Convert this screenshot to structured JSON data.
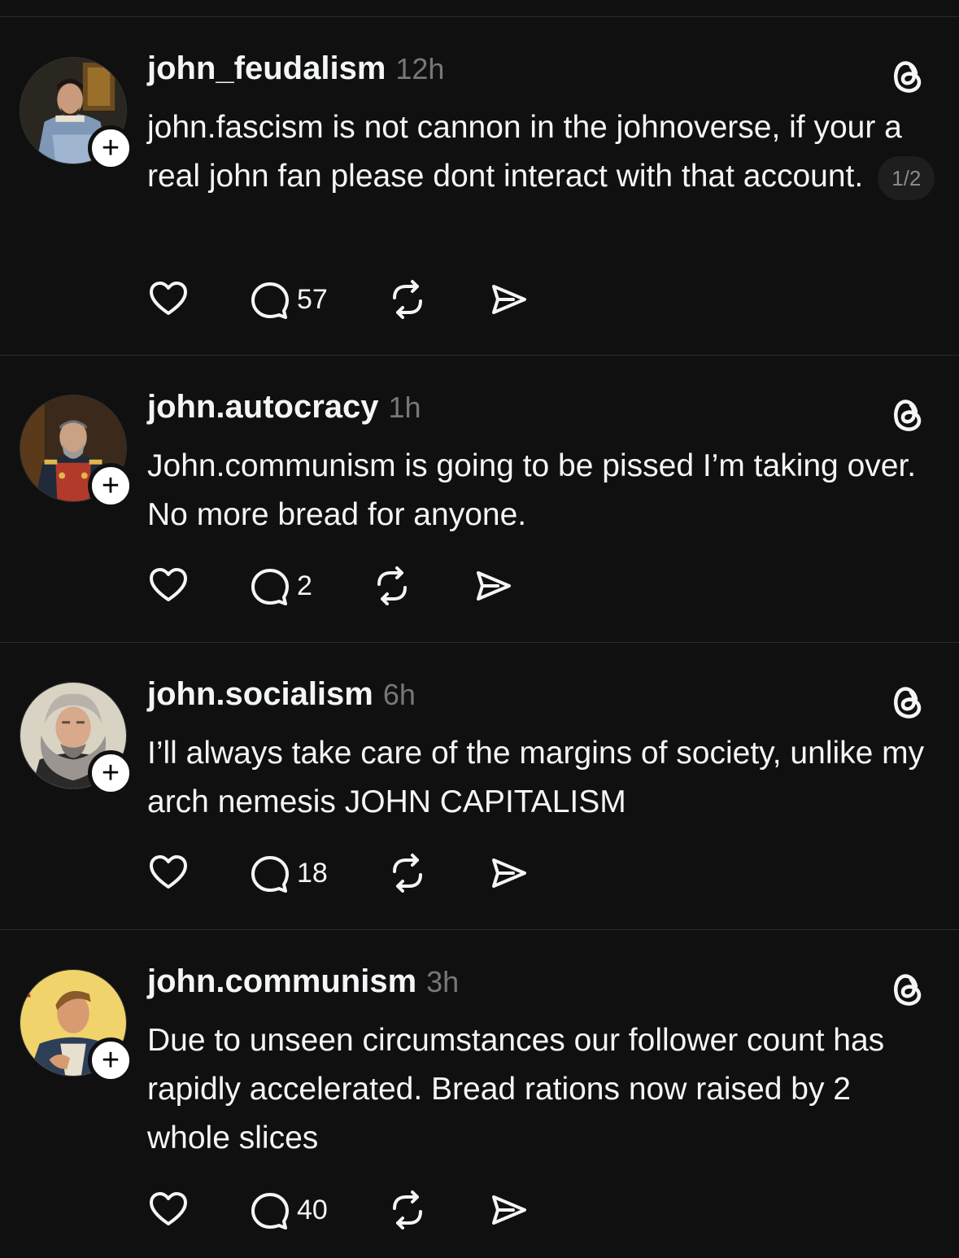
{
  "posts": [
    {
      "username": "john_feudalism",
      "time": "12h",
      "text": "john.fascism is not cannon in the johnoverse, if your a real john fan please dont interact with that account.",
      "pager": "1/2",
      "replies": "57",
      "avatar": "tudor-nobleman-portrait",
      "follow_label": "+"
    },
    {
      "username": "john.autocracy",
      "time": "1h",
      "text": "John.communism is going to be pissed I’m taking over. No more bread for anyone.",
      "replies": "2",
      "avatar": "tsar-portrait",
      "follow_label": "+"
    },
    {
      "username": "john.socialism",
      "time": "6h",
      "text": "I’ll always take care of the margins of society, unlike my arch nemesis JOHN CAPITALISM",
      "replies": "18",
      "avatar": "bearded-philosopher-portrait",
      "follow_label": "+"
    },
    {
      "username": "john.communism",
      "time": "3h",
      "text": "Due to unseen circumstances our follower count has rapidly accelerated. Bread rations now raised by  2 whole slices",
      "replies": "40",
      "avatar": "propaganda-poster-portrait",
      "follow_label": "+"
    }
  ],
  "icons": {
    "like": "heart-icon",
    "reply": "comment-icon",
    "repost": "repost-icon",
    "share": "send-icon",
    "brand": "threads-logo-icon"
  },
  "colors": {
    "background": "#101010",
    "text": "#f3f5f7",
    "muted": "#777777",
    "divider": "#2a2a2a"
  }
}
